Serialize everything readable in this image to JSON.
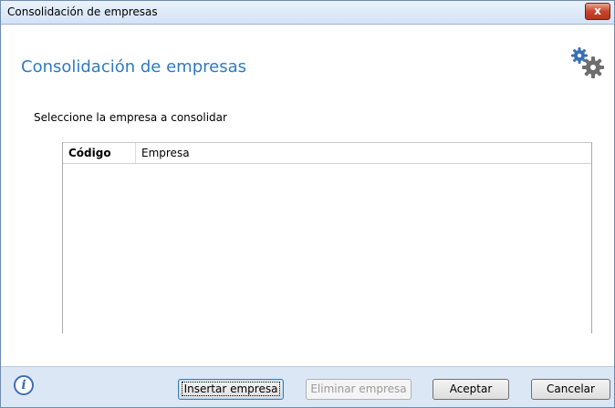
{
  "window": {
    "title": "Consolidación de empresas",
    "close_label": "x"
  },
  "header": {
    "title": "Consolidación de empresas",
    "icon": "gears-icon"
  },
  "main": {
    "prompt": "Seleccione la empresa a consolidar",
    "table": {
      "columns": [
        "Código",
        "Empresa"
      ],
      "rows": []
    }
  },
  "footer": {
    "info_icon": "info-icon",
    "info_glyph": "i",
    "buttons": {
      "insert_label": "Insertar empresa",
      "delete_label": "Eliminar empresa",
      "accept_label": "Aceptar",
      "cancel_label": "Cancelar"
    }
  },
  "colors": {
    "accent": "#2e7ac2",
    "footer_bg": "#dce7f5",
    "close_red": "#c7452d"
  }
}
